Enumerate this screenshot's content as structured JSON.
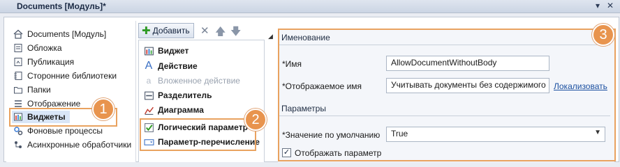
{
  "window": {
    "title": "Documents [Модуль]*",
    "controls": [
      "▾",
      "✕"
    ]
  },
  "tree": {
    "items": [
      {
        "label": "Documents [Модуль]",
        "icon": "home-icon"
      },
      {
        "label": "Обложка",
        "icon": "cover-icon"
      },
      {
        "label": "Публикация",
        "icon": "publication-icon"
      },
      {
        "label": "Сторонние библиотеки",
        "icon": "library-icon"
      },
      {
        "label": "Папки",
        "icon": "folder-icon"
      },
      {
        "label": "Отображение",
        "icon": "list-icon"
      },
      {
        "label": "Виджеты",
        "icon": "widget-icon",
        "selected": true
      },
      {
        "label": "Фоновые процессы",
        "icon": "gears-icon"
      },
      {
        "label": "Асинхронные обработчики",
        "icon": "async-icon"
      }
    ]
  },
  "toolbar": {
    "add_label": "Добавить"
  },
  "widget_list": {
    "items": [
      {
        "label": "Виджет",
        "icon": "widget-icon",
        "bold": true
      },
      {
        "label": "Действие",
        "icon": "letter-a-icon",
        "bold": true
      },
      {
        "label": "Вложенное действие",
        "icon": "letter-a-small-icon",
        "disabled": true
      },
      {
        "label": "Разделитель",
        "icon": "divider-icon",
        "bold": true
      },
      {
        "label": "Диаграмма",
        "icon": "chart-icon",
        "bold": true
      },
      {
        "label": "Логический параметр",
        "icon": "checkmark-icon",
        "bold": true
      },
      {
        "label": "Параметр-перечисление",
        "icon": "enum-dropdown-icon",
        "bold": true
      }
    ]
  },
  "properties": {
    "naming_header": "Именование",
    "name_label": "*Имя",
    "name_value": "AllowDocumentWithoutBody",
    "display_name_label": "*Отображаемое имя",
    "display_name_value": "Учитывать документы без содержимого",
    "localize_link": "Локализовать",
    "params_header": "Параметры",
    "default_value_label": "*Значение по умолчанию",
    "default_value": "True",
    "show_param_label": "Отображать параметр",
    "show_param_checked": true
  },
  "callouts": [
    "1",
    "2",
    "3"
  ],
  "colors": {
    "accent_callout": "#e8944e",
    "link": "#1a4fa0",
    "selection": "#d9e6f7"
  }
}
